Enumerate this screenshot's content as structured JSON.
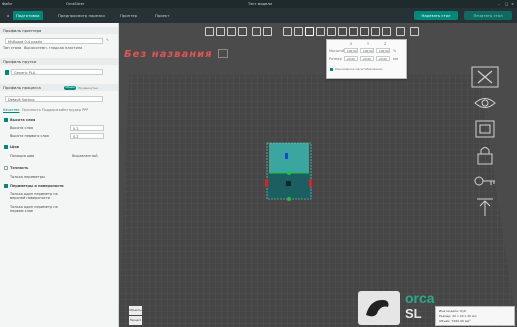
{
  "titlebar": {
    "file_label": "Файл",
    "slicer_label": "OrcaSlicer",
    "center_title": "Тест модели"
  },
  "tabs": [
    {
      "label": "Подготовка",
      "active": true
    },
    {
      "label": "Предпросмотр нарезки",
      "active": false
    },
    {
      "label": "Принтер",
      "active": false
    },
    {
      "label": "Проект",
      "active": false
    }
  ],
  "actions": {
    "slice_label": "Нарезать стол",
    "export_label": "Печатать стол"
  },
  "sidebar": {
    "printer_section": "Профиль принтера",
    "printer_value": "MyBoard 0.4 nozzle",
    "plate_row": "Тип стола",
    "plate_value": "Высокотемп. гладкая пластина",
    "filament_section": "Профиль прутка",
    "filament_value": "Generic PLA",
    "process_section": "Профиль процесса",
    "process_value": "Default Setting",
    "process_modes": [
      "Общие",
      "Продвинутые"
    ],
    "settings_tabs": [
      "Качество",
      "Прочность",
      "Поддержки",
      "Экструдер PPP"
    ],
    "layer_height_header": "Высота слоя",
    "layer_height_label": "Высота слоя",
    "layer_height_value": "0.2",
    "first_layer_label": "Высота первого слоя",
    "first_layer_value": "0.2",
    "seam_header": "Шов",
    "seam_label": "Позиция шва",
    "seam_value": "Выравненный",
    "precision_header": "Точность",
    "precision_label": "Только периметры",
    "walls_header": "Периметры и поверхности",
    "walls_label1": "Только один периметр на верхней поверхности",
    "walls_label2": "Только один периметр на первом слое"
  },
  "viewport": {
    "plate_title": "Без названия",
    "popup_headers": [
      "X",
      "Y",
      "Z"
    ],
    "popup_rows": [
      {
        "label": "Масштаб",
        "values": [
          "100.00",
          "100.00",
          "100.00"
        ],
        "unit": "%"
      },
      {
        "label": "Размер",
        "values": [
          "20.00",
          "20.00",
          "20.00"
        ],
        "unit": "мм"
      }
    ],
    "popup_check": "Равномерное масштабирование",
    "bottom_tabs": [
      "Объекты",
      "Процесс"
    ],
    "brand": "orca",
    "brand_sub": "SL",
    "notif_lines": [
      "Имя модели: Куб",
      "Размер: 20 x 20 x 20 мм",
      "Объём: 7999.99 мм³"
    ]
  },
  "colors": {
    "accent": "#00897b",
    "plate_title": "#e05555",
    "cube_top": "#3ba6a0",
    "cube_front": "#1c5f60"
  },
  "icons": [
    "home-icon",
    "undo-icon",
    "redo-icon",
    "save-icon",
    "add-icon",
    "grid-icon",
    "rotate-icon",
    "scale-icon",
    "cut-icon",
    "measure-icon",
    "paint-icon",
    "text-icon",
    "arrange-icon",
    "orient-icon",
    "view-iso-icon",
    "view-front-icon",
    "view-top-icon",
    "lock-icon",
    "plate-flat-icon",
    "lift-icon"
  ]
}
